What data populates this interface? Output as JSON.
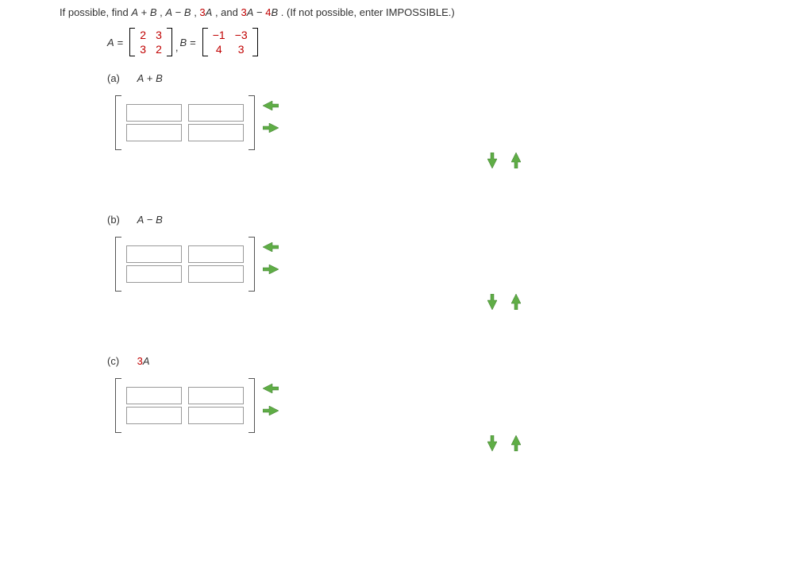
{
  "question": {
    "prefix": "If possible, find ",
    "e1": "A",
    "plus": " + ",
    "e2": "B",
    "c1": ", ",
    "e3": "A",
    "minus": " − ",
    "e4": "B",
    "c2": ", ",
    "e5": "3",
    "e6": "A",
    "c3": ", and ",
    "e7": "3",
    "e8": "A",
    "minus2": " − ",
    "e9": "4",
    "e10": "B",
    "suffix": ".  (If not possible, enter IMPOSSIBLE.)"
  },
  "defs": {
    "A_label": "A",
    "eq": " = ",
    "A": {
      "r1c1": "2",
      "r1c2": "3",
      "r2c1": "3",
      "r2c2": "2"
    },
    "comma": ", ",
    "B_label": "B",
    "B": {
      "r1c1": "−1",
      "r1c2": "−3",
      "r2c1": "4",
      "r2c2": "3"
    }
  },
  "parts": {
    "a": {
      "label": "(a)",
      "expr_l": "A",
      "op": " + ",
      "expr_r": "B"
    },
    "b": {
      "label": "(b)",
      "expr_l": "A",
      "op": " − ",
      "expr_r": "B"
    },
    "c": {
      "label": "(c)",
      "coef": "3",
      "expr": "A"
    }
  },
  "arrows": {
    "left": "←",
    "right": "→",
    "down": "↓",
    "up": "↑"
  }
}
